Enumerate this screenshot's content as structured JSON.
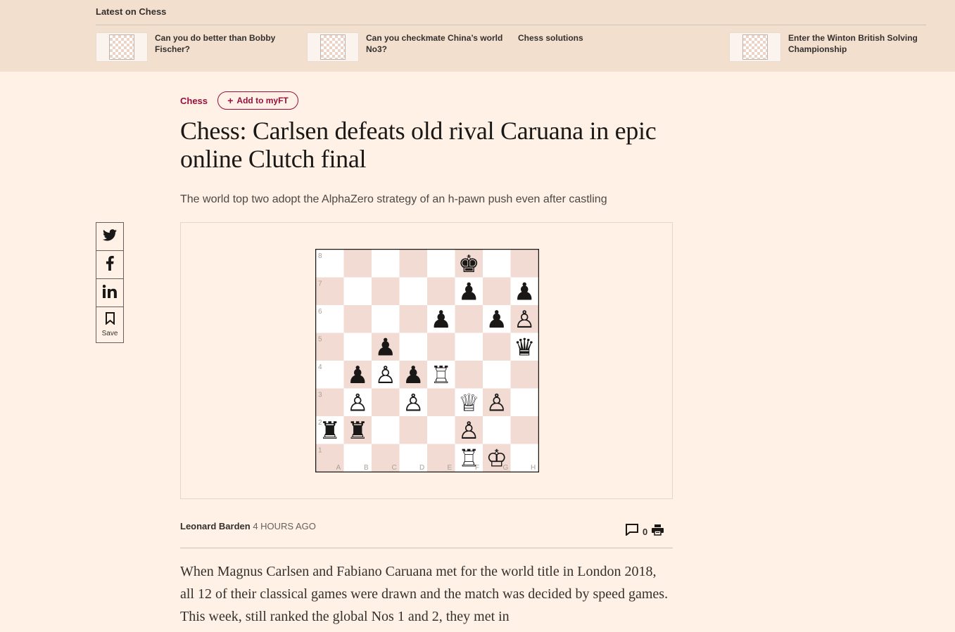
{
  "latest": {
    "title": "Latest on Chess",
    "items": [
      {
        "label": "Can you do better than Bobby Fischer?"
      },
      {
        "label": "Can you checkmate China’s world No3?"
      },
      {
        "label": "Chess solutions"
      },
      {
        "label": "Enter the Winton British Solving Championship"
      }
    ]
  },
  "article": {
    "topic": "Chess",
    "myft_label": "Add to myFT",
    "headline": "Chess: Carlsen defeats old rival Caruana in epic online Clutch final",
    "standfirst": "The world top two adopt the AlphaZero strategy of an h-pawn push even after castling",
    "author": "Leonard Barden",
    "time": "4 HOURS AGO",
    "comment_count": "0",
    "body": "When Magnus Carlsen and Fabiano Caruana met for the world title in London 2018, all 12 of their classical games were drawn and the match was decided by speed games. This week, still ranked the global Nos 1 and 2, they met in"
  },
  "share": {
    "icons": [
      "twitter-icon",
      "facebook-icon",
      "linkedin-icon",
      "bookmark-icon"
    ],
    "save_label": "Save"
  },
  "board": {
    "files": [
      "A",
      "B",
      "C",
      "D",
      "E",
      "F",
      "G",
      "H"
    ],
    "ranks": [
      "8",
      "7",
      "6",
      "5",
      "4",
      "3",
      "2",
      "1"
    ],
    "light_color": "#ffffff",
    "dark_color": "#f1dbd2",
    "pieces": [
      {
        "square": "f8",
        "glyph": "♚"
      },
      {
        "square": "f7",
        "glyph": "♟"
      },
      {
        "square": "h7",
        "glyph": "♟"
      },
      {
        "square": "e6",
        "glyph": "♟"
      },
      {
        "square": "g6",
        "glyph": "♟"
      },
      {
        "square": "h6",
        "glyph": "♙"
      },
      {
        "square": "c5",
        "glyph": "♟"
      },
      {
        "square": "h5",
        "glyph": "♛"
      },
      {
        "square": "b4",
        "glyph": "♟"
      },
      {
        "square": "c4",
        "glyph": "♙"
      },
      {
        "square": "d4",
        "glyph": "♟"
      },
      {
        "square": "e4",
        "glyph": "♖"
      },
      {
        "square": "b3",
        "glyph": "♙"
      },
      {
        "square": "d3",
        "glyph": "♙"
      },
      {
        "square": "f3",
        "glyph": "♕"
      },
      {
        "square": "g3",
        "glyph": "♙"
      },
      {
        "square": "a2",
        "glyph": "♜"
      },
      {
        "square": "b2",
        "glyph": "♜"
      },
      {
        "square": "f2",
        "glyph": "♙"
      },
      {
        "square": "f1",
        "glyph": "♖"
      },
      {
        "square": "g1",
        "glyph": "♔"
      }
    ]
  },
  "colors": {
    "background": "#fff1e5",
    "claret": "#990f3d",
    "bar": "#f2dfce"
  }
}
